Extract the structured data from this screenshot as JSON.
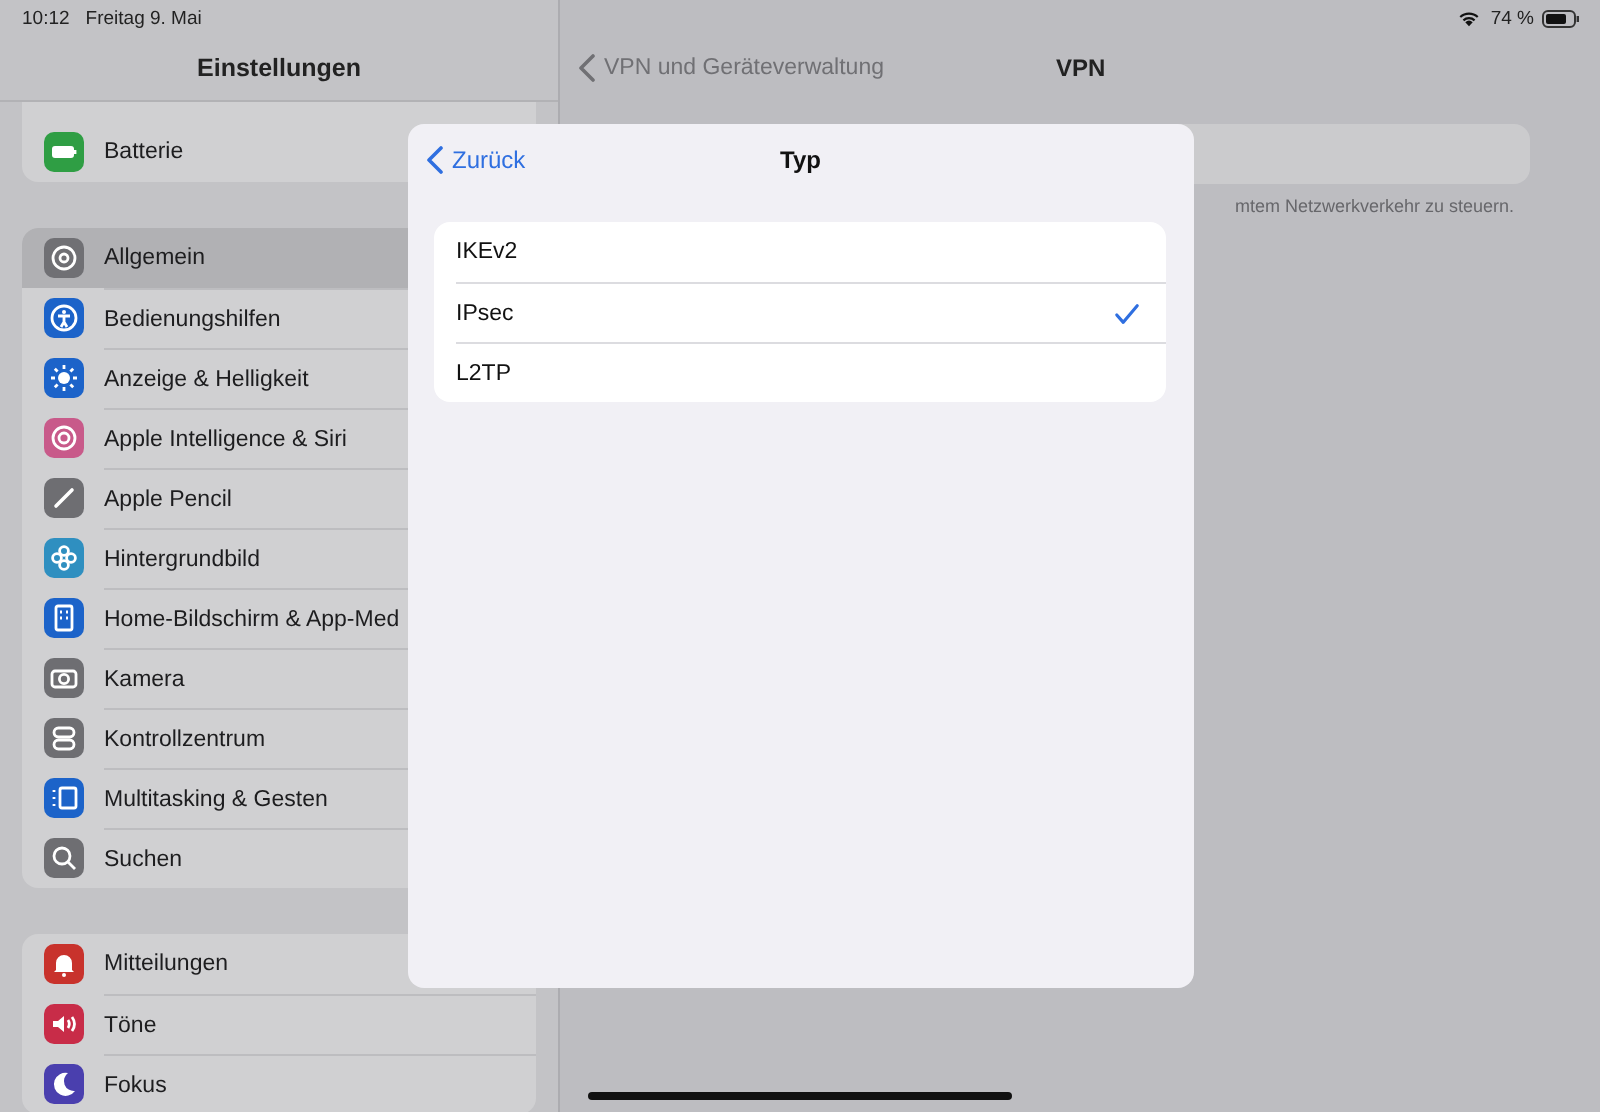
{
  "status_bar": {
    "time": "10:12",
    "date": "Freitag 9. Mai",
    "battery": "74 %"
  },
  "sidebar": {
    "title": "Einstellungen",
    "groups": [
      {
        "items": [
          {
            "label": "Batterie",
            "color": "#2f9e44",
            "selected": false
          }
        ]
      },
      {
        "items": [
          {
            "label": "Allgemein",
            "color": "#707074",
            "selected": true
          },
          {
            "label": "Bedienungshilfen",
            "color": "#1c63c9",
            "selected": false
          },
          {
            "label": "Anzeige & Helligkeit",
            "color": "#1c63c9",
            "selected": false
          },
          {
            "label": "Apple Intelligence & Siri",
            "color": "#c85a8a",
            "selected": false
          },
          {
            "label": "Apple Pencil",
            "color": "#6e6e72",
            "selected": false
          },
          {
            "label": "Hintergrundbild",
            "color": "#2f8fc0",
            "selected": false
          },
          {
            "label": "Home-Bildschirm & App-Med",
            "color": "#1c63c9",
            "selected": false
          },
          {
            "label": "Kamera",
            "color": "#6e6e72",
            "selected": false
          },
          {
            "label": "Kontrollzentrum",
            "color": "#6e6e72",
            "selected": false
          },
          {
            "label": "Multitasking & Gesten",
            "color": "#1c63c9",
            "selected": false
          },
          {
            "label": "Suchen",
            "color": "#6e6e72",
            "selected": false
          }
        ]
      },
      {
        "items": [
          {
            "label": "Mitteilungen",
            "color": "#c8322c",
            "selected": false
          },
          {
            "label": "Töne",
            "color": "#c82c48",
            "selected": false
          },
          {
            "label": "Fokus",
            "color": "#4a3fae",
            "selected": false
          }
        ]
      }
    ]
  },
  "detail": {
    "back": "VPN und Geräteverwaltung",
    "title": "VPN",
    "footer": "mtem Netzwerkverkehr zu steuern."
  },
  "modal": {
    "back": "Zurück",
    "title": "Typ",
    "options": [
      {
        "label": "IKEv2",
        "selected": false
      },
      {
        "label": "IPsec",
        "selected": true
      },
      {
        "label": "L2TP",
        "selected": false
      }
    ]
  }
}
